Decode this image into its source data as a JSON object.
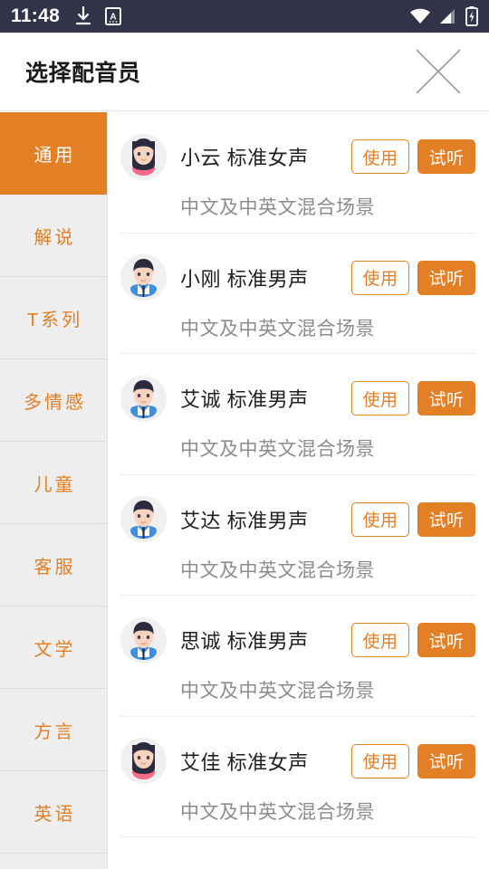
{
  "statusbar": {
    "time": "11:48",
    "left_icons": [
      "download-icon",
      "app-badge-a-icon"
    ],
    "right_icons": [
      "wifi-icon",
      "cellular-signal-icon",
      "battery-charging-icon"
    ],
    "background_color": "#323349"
  },
  "header": {
    "title": "选择配音员",
    "close_icon": "close-icon"
  },
  "theme": {
    "accent": "#e37f24",
    "sidebar_bg": "#eeeeee",
    "divider": "#ececec",
    "text_primary": "#1f1f1f",
    "text_secondary": "#8c8c8c"
  },
  "sidebar": {
    "items": [
      {
        "label": "通用",
        "active": true
      },
      {
        "label": "解说",
        "active": false
      },
      {
        "label": "T系列",
        "active": false
      },
      {
        "label": "多情感",
        "active": false
      },
      {
        "label": "儿童",
        "active": false
      },
      {
        "label": "客服",
        "active": false
      },
      {
        "label": "文学",
        "active": false
      },
      {
        "label": "方言",
        "active": false
      },
      {
        "label": "英语",
        "active": false
      }
    ]
  },
  "buttons": {
    "use_label": "使用",
    "try_label": "试听"
  },
  "voices": [
    {
      "name": "小云",
      "type": "标准女声",
      "desc": "中文及中英文混合场景",
      "avatar": "avatar-female"
    },
    {
      "name": "小刚",
      "type": "标准男声",
      "desc": "中文及中英文混合场景",
      "avatar": "avatar-male"
    },
    {
      "name": "艾诚",
      "type": "标准男声",
      "desc": "中文及中英文混合场景",
      "avatar": "avatar-male"
    },
    {
      "name": "艾达",
      "type": "标准男声",
      "desc": "中文及中英文混合场景",
      "avatar": "avatar-male"
    },
    {
      "name": "思诚",
      "type": "标准男声",
      "desc": "中文及中英文混合场景",
      "avatar": "avatar-male"
    },
    {
      "name": "艾佳",
      "type": "标准女声",
      "desc": "中文及中英文混合场景",
      "avatar": "avatar-female"
    }
  ]
}
